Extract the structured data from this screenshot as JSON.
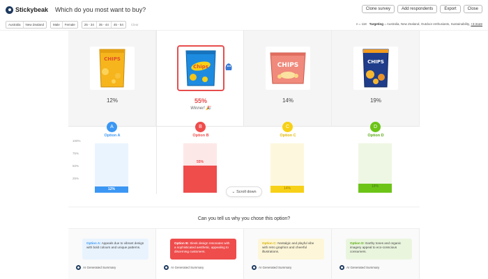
{
  "app": {
    "name": "Stickybeak",
    "question": "Which do you most want to buy?"
  },
  "toolbar": {
    "clone": "Clone survey",
    "add": "Add respondents",
    "export": "Export",
    "close": "Close"
  },
  "filters": {
    "countries": [
      "Australia",
      "New Zealand"
    ],
    "genders": [
      "Male",
      "Female"
    ],
    "ages": [
      "25 - 34",
      "35 - 44",
      "45 - 54"
    ],
    "clear": "Clear",
    "respondents": "n = 118",
    "targeting_label": "Targeting",
    "targeting_value": "= Australia, New Zealand, Outdoor enthusiasts, Sustainability,",
    "more": "+3 more"
  },
  "options": [
    {
      "letter": "A",
      "label": "Option A",
      "percent_text": "12%",
      "value": 12,
      "color": "#3b97f3",
      "light": "#eaf4fe",
      "product": "CHIPS"
    },
    {
      "letter": "B",
      "label": "Option B",
      "percent_text": "55%",
      "value": 55,
      "color": "#ef4c4c",
      "light": "#fde8e8",
      "product": "Chips",
      "winner_text": "Winner! 🎉"
    },
    {
      "letter": "C",
      "label": "Option C",
      "percent_text": "14%",
      "value": 14,
      "color": "#f7d117",
      "light": "#fdf8dd",
      "product": "CHIPS"
    },
    {
      "letter": "D",
      "label": "Option D",
      "percent_text": "19%",
      "value": 19,
      "color": "#6cc417",
      "light": "#eef7e3",
      "product": "CHIPS"
    }
  ],
  "axis": [
    "100%",
    "75%",
    "50%",
    "25%"
  ],
  "scroll_label": "Scroll down",
  "why_question": "Can you tell us why you chose this option?",
  "summaries": [
    {
      "name": "Option A:",
      "text": "Appeals due to vibrant design with bold colours and unique patterns."
    },
    {
      "name": "Option B:",
      "text": "Sleek design resonates with a sophisticated aesthetic, appealing to discerning customers."
    },
    {
      "name": "Option C:",
      "text": "Nostalgic and playful vibe with retro graphics and cheerful illustrations."
    },
    {
      "name": "Option D:",
      "text": "Earthy tones and organic imagery appeal to eco-conscious consumers."
    }
  ],
  "ai_label": "AI Generated Summary"
}
